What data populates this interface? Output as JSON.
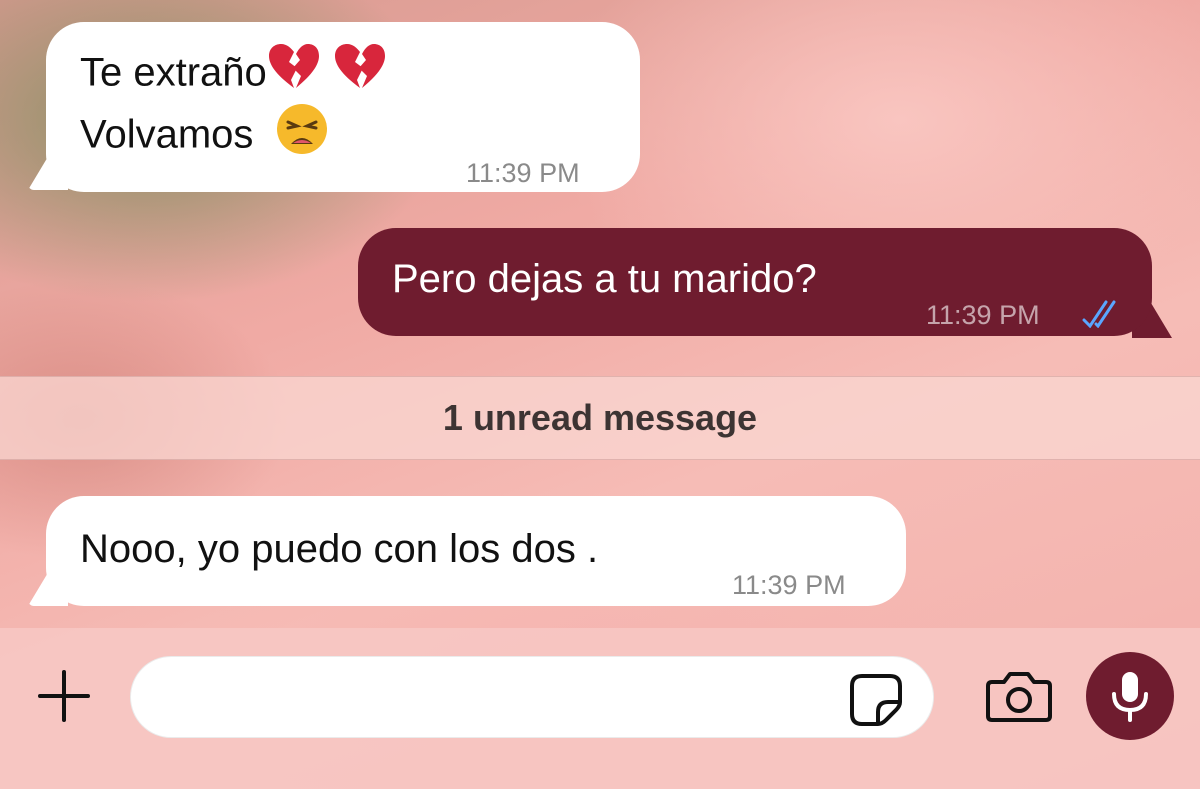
{
  "messages": [
    {
      "direction": "incoming",
      "line1": "Te extraño",
      "line1_emojis": [
        "broken-heart-emoji",
        "broken-heart-emoji"
      ],
      "line2": "Volvamos",
      "line2_emojis": [
        "weary-face-emoji"
      ],
      "time": "11:39 PM"
    },
    {
      "direction": "outgoing",
      "text": "Pero dejas a tu marido?",
      "time": "11:39 PM",
      "status_icon": "double-check-read-icon"
    },
    {
      "direction": "incoming",
      "text": "Nooo, yo puedo con los dos .",
      "time": "11:39 PM"
    }
  ],
  "unread_divider": {
    "label": "1 unread message"
  },
  "composer": {
    "placeholder": "",
    "icons": [
      "plus-icon",
      "sticker-icon",
      "camera-icon",
      "microphone-icon"
    ]
  },
  "colors": {
    "outgoing_bubble": "#6f1c2f",
    "incoming_bubble": "#ffffff",
    "read_ticks": "#5aa6ff",
    "mic_button": "#6f1c2f"
  }
}
